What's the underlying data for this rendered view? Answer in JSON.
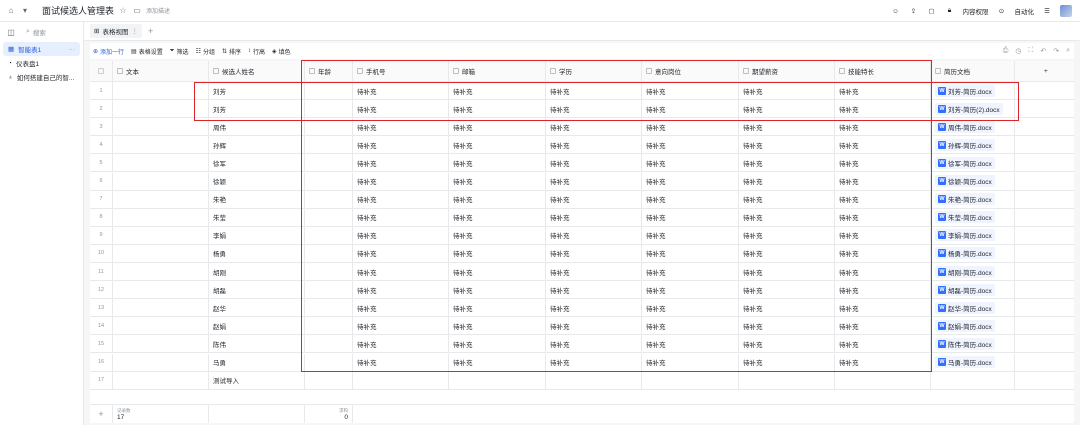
{
  "topbar": {
    "title": "面试候选人管理表",
    "tag": "添加描述",
    "share": "内容权限",
    "auto": "自动化"
  },
  "sidebar": {
    "search": "搜索",
    "items": [
      {
        "label": "智能表1",
        "icon": "table-icon"
      },
      {
        "label": "仪表盘1",
        "icon": "dashboard-icon"
      },
      {
        "label": "如何搭建自己的智...",
        "icon": "bulb-icon"
      }
    ]
  },
  "view_tab": "表格视图",
  "toolbar": {
    "add": "添加一行",
    "settings": "表格设置",
    "filter": "筛选",
    "group": "分组",
    "sort": "排序",
    "rowheight": "行高",
    "fill": "填色"
  },
  "columns": [
    "文本",
    "候选人姓名",
    "年龄",
    "手机号",
    "邮箱",
    "学历",
    "意向岗位",
    "期望薪资",
    "技能特长",
    "简历文档"
  ],
  "rows": [
    {
      "idx": "1",
      "name": "刘芳",
      "fill": "待补充",
      "doc": "刘芳-简历.docx"
    },
    {
      "idx": "2",
      "name": "刘芳",
      "fill": "待补充",
      "doc": "刘芳-简历(2).docx"
    },
    {
      "idx": "3",
      "name": "周伟",
      "fill": "待补充",
      "doc": "周伟-简历.docx"
    },
    {
      "idx": "4",
      "name": "孙辉",
      "fill": "待补充",
      "doc": "孙辉-简历.docx"
    },
    {
      "idx": "5",
      "name": "徐军",
      "fill": "待补充",
      "doc": "徐军-简历.docx"
    },
    {
      "idx": "6",
      "name": "徐颖",
      "fill": "待补充",
      "doc": "徐颖-简历.docx"
    },
    {
      "idx": "7",
      "name": "朱艳",
      "fill": "待补充",
      "doc": "朱艳-简历.docx"
    },
    {
      "idx": "8",
      "name": "朱莹",
      "fill": "待补充",
      "doc": "朱莹-简历.docx"
    },
    {
      "idx": "9",
      "name": "李娟",
      "fill": "待补充",
      "doc": "李娟-简历.docx"
    },
    {
      "idx": "10",
      "name": "杨勇",
      "fill": "待补充",
      "doc": "杨勇-简历.docx"
    },
    {
      "idx": "11",
      "name": "胡刚",
      "fill": "待补充",
      "doc": "胡刚-简历.docx"
    },
    {
      "idx": "12",
      "name": "胡磊",
      "fill": "待补充",
      "doc": "胡磊-简历.docx"
    },
    {
      "idx": "13",
      "name": "赵华",
      "fill": "待补充",
      "doc": "赵华-简历.docx"
    },
    {
      "idx": "14",
      "name": "赵娟",
      "fill": "待补充",
      "doc": "赵娟-简历.docx"
    },
    {
      "idx": "15",
      "name": "陈伟",
      "fill": "待补充",
      "doc": "陈伟-简历.docx"
    },
    {
      "idx": "16",
      "name": "马勇",
      "fill": "待补充",
      "doc": "马勇-简历.docx"
    },
    {
      "idx": "17",
      "name": "测试导入",
      "fill": "",
      "doc": ""
    }
  ],
  "footer": {
    "record_label": "记录数",
    "record_value": "17",
    "sum_label": "求和",
    "sum_value": "0"
  },
  "colors": {
    "accent": "#245bdb",
    "highlight": "#d9262b"
  }
}
